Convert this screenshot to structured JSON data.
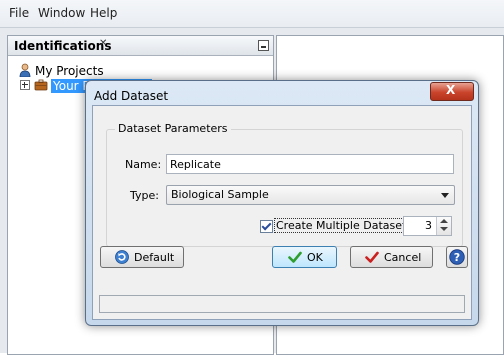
{
  "menu": {
    "file": "File",
    "window": "Window",
    "help": "Help"
  },
  "left_panel": {
    "title": "Identifications",
    "close_glyph": "✕",
    "tree": {
      "root": "My Projects",
      "child": "Your P"
    }
  },
  "dialog": {
    "title": "Add Dataset",
    "close_glyph": "X",
    "group_title": "Dataset Parameters",
    "name_label": "Name:",
    "name_value": "Replicate",
    "type_label": "Type:",
    "type_value": "Biological Sample",
    "multi_label": "Create Multiple Datasets",
    "multi_checked": true,
    "count_value": "3",
    "buttons": {
      "default": "Default",
      "ok": "OK",
      "cancel": "Cancel",
      "help_glyph": "?"
    }
  },
  "icons": {
    "person": "person-icon",
    "briefcase": "briefcase-icon",
    "refresh": "refresh-icon",
    "ok": "checkmark-icon",
    "cancel": "cancel-check-icon",
    "help": "help-icon"
  },
  "colors": {
    "selection": "#3399ff",
    "ok_check": "#2e9e2e",
    "cancel_check": "#cc2020",
    "help_blue": "#2f5fb5",
    "close_red": "#c9442b"
  }
}
